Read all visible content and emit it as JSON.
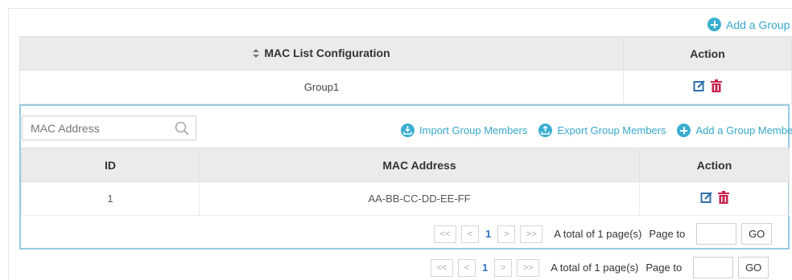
{
  "top_link": {
    "add_group_label": "Add a Group"
  },
  "group_table": {
    "headers": {
      "config": "MAC List Configuration",
      "action": "Action"
    },
    "rows": [
      {
        "name": "Group1"
      }
    ]
  },
  "members": {
    "search": {
      "placeholder": "MAC Address"
    },
    "actions": {
      "import_label": "Import Group Members",
      "export_label": "Export Group Members",
      "add_member_label": "Add a Group Member"
    },
    "headers": {
      "id": "ID",
      "mac": "MAC Address",
      "action": "Action"
    },
    "rows": [
      {
        "id": "1",
        "mac": "AA-BB-CC-DD-EE-FF"
      }
    ],
    "pager": {
      "first": "<<",
      "prev": "<",
      "current": "1",
      "next": ">",
      "last": ">>",
      "total_text": "A total of 1 page(s)",
      "page_to": "Page to",
      "go": "GO"
    }
  },
  "outer_pager": {
    "first": "<<",
    "prev": "<",
    "current": "1",
    "next": ">",
    "last": ">>",
    "total_text": "A total of 1 page(s)",
    "page_to": "Page to",
    "go": "GO"
  },
  "colors": {
    "accent": "#3aaed0",
    "delete": "#c8234f",
    "edit": "#2f6fa8",
    "header_bg": "#ebebeb",
    "frame": "#97cbdf"
  }
}
